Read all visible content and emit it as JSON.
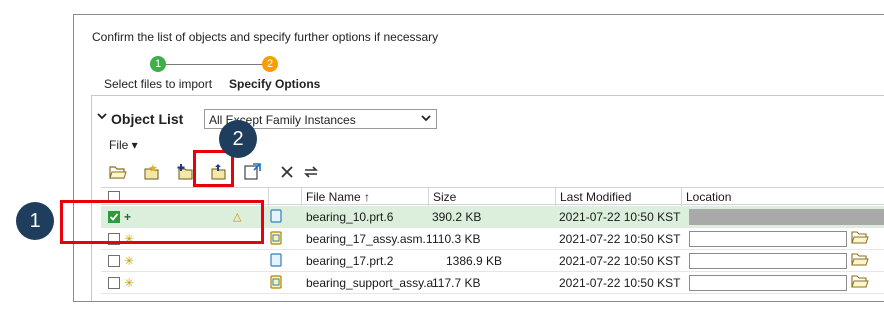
{
  "wizard": {
    "instruction": "Confirm the list of objects and specify further options if necessary",
    "steps": [
      {
        "number": "1",
        "label": "Select files to import",
        "status": "complete",
        "color": "#3fae49"
      },
      {
        "number": "2",
        "label": "Specify Options",
        "status": "current",
        "color": "#f5a000"
      }
    ]
  },
  "object_list": {
    "title": "Object List",
    "filter_value": "All Except Family Instances",
    "file_menu": "File ▾",
    "toolbar_icons": [
      "folder-open-icon",
      "new-object-icon",
      "add-object-icon",
      "import-object-icon",
      "export-object-icon",
      "remove-icon",
      "swap-icon"
    ],
    "columns": {
      "file_name": "File Name ↑",
      "size": "Size",
      "last_modified": "Last Modified",
      "location": "Location"
    },
    "rows": [
      {
        "checked": true,
        "status_icon": "+",
        "warning": "△",
        "file_name": "bearing_10.prt.6",
        "size": "390.2 KB",
        "last_modified": "2021-07-22 10:50 KST",
        "file_type": "part",
        "selected": true
      },
      {
        "checked": false,
        "status_icon": "✳",
        "warning": "",
        "file_name": "bearing_17_assy.asm.1",
        "size": "110.3 KB",
        "last_modified": "2021-07-22 10:50 KST",
        "file_type": "assembly",
        "selected": false
      },
      {
        "checked": false,
        "status_icon": "✳",
        "warning": "",
        "file_name": "bearing_17.prt.2",
        "size": "1386.9 KB",
        "last_modified": "2021-07-22 10:50 KST",
        "file_type": "part",
        "selected": false
      },
      {
        "checked": false,
        "status_icon": "✳",
        "warning": "",
        "file_name": "bearing_support_assy.a",
        "size": "117.7 KB",
        "last_modified": "2021-07-22 10:50 KST",
        "file_type": "assembly",
        "selected": false
      }
    ]
  },
  "annotations": {
    "callout_1": "1",
    "callout_2": "2",
    "callout_color": "#1f3d5c",
    "box_color": "#e8000b"
  }
}
